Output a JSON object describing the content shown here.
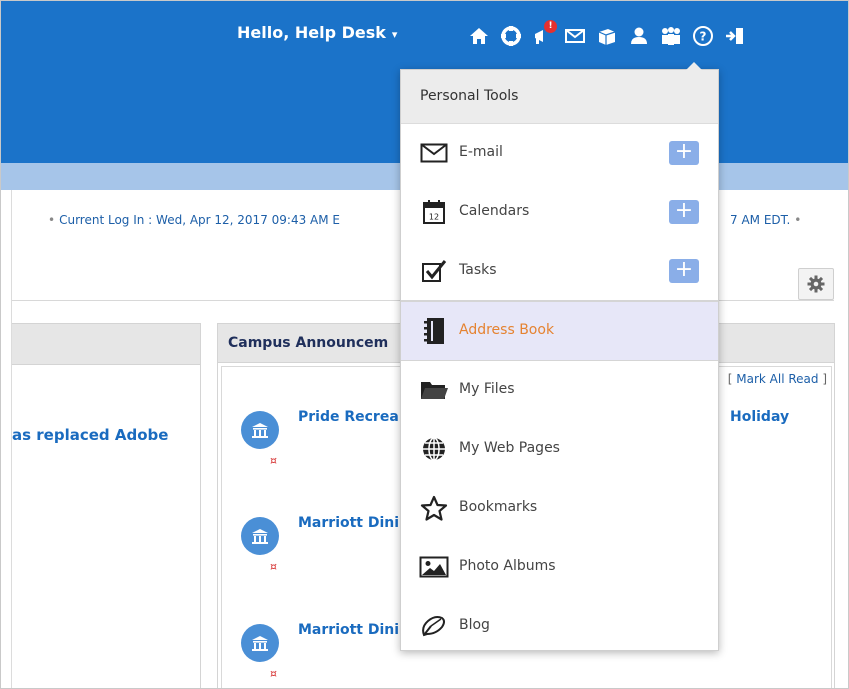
{
  "header": {
    "greeting": "Hello, Help Desk",
    "caret": "▾",
    "icons": [
      "home-icon",
      "support-icon",
      "announcements-icon",
      "email-icon",
      "courses-icon",
      "personal-tools-icon",
      "groups-icon",
      "help-icon",
      "logout-icon"
    ],
    "notification_badge": "!"
  },
  "login_info": {
    "current": "Current Log In : Wed, Apr 12, 2017 09:43 AM E",
    "previous_tail": "7 AM EDT."
  },
  "left_panel": {
    "link_text": "as replaced Adobe"
  },
  "announcements": {
    "title": "Campus Announcem",
    "mark_all_read": "Mark All Read",
    "items": [
      {
        "title": "Pride Recrea",
        "right_text": "Holiday"
      },
      {
        "title": "Marriott Dini"
      },
      {
        "title": "Marriott Dini"
      }
    ],
    "flag_glyph": "¤"
  },
  "personal_tools": {
    "header": "Personal Tools",
    "items": [
      {
        "label": "E-mail",
        "icon": "envelope-icon",
        "add": "+"
      },
      {
        "label": "Calendars",
        "icon": "calendar-icon",
        "add": "+"
      },
      {
        "label": "Tasks",
        "icon": "checkbox-icon",
        "add": "+"
      },
      {
        "label": "Address Book",
        "icon": "address-book-icon"
      },
      {
        "label": "My Files",
        "icon": "folder-icon"
      },
      {
        "label": "My Web Pages",
        "icon": "globe-icon"
      },
      {
        "label": "Bookmarks",
        "icon": "star-icon"
      },
      {
        "label": "Photo Albums",
        "icon": "photo-icon"
      },
      {
        "label": "Blog",
        "icon": "blog-icon"
      }
    ]
  },
  "colors": {
    "header_blue": "#1b73c9",
    "sub_bar": "#a6c5e9",
    "link_blue": "#1a6bbf",
    "active_label": "#e58331",
    "add_button": "#8aaee8"
  }
}
